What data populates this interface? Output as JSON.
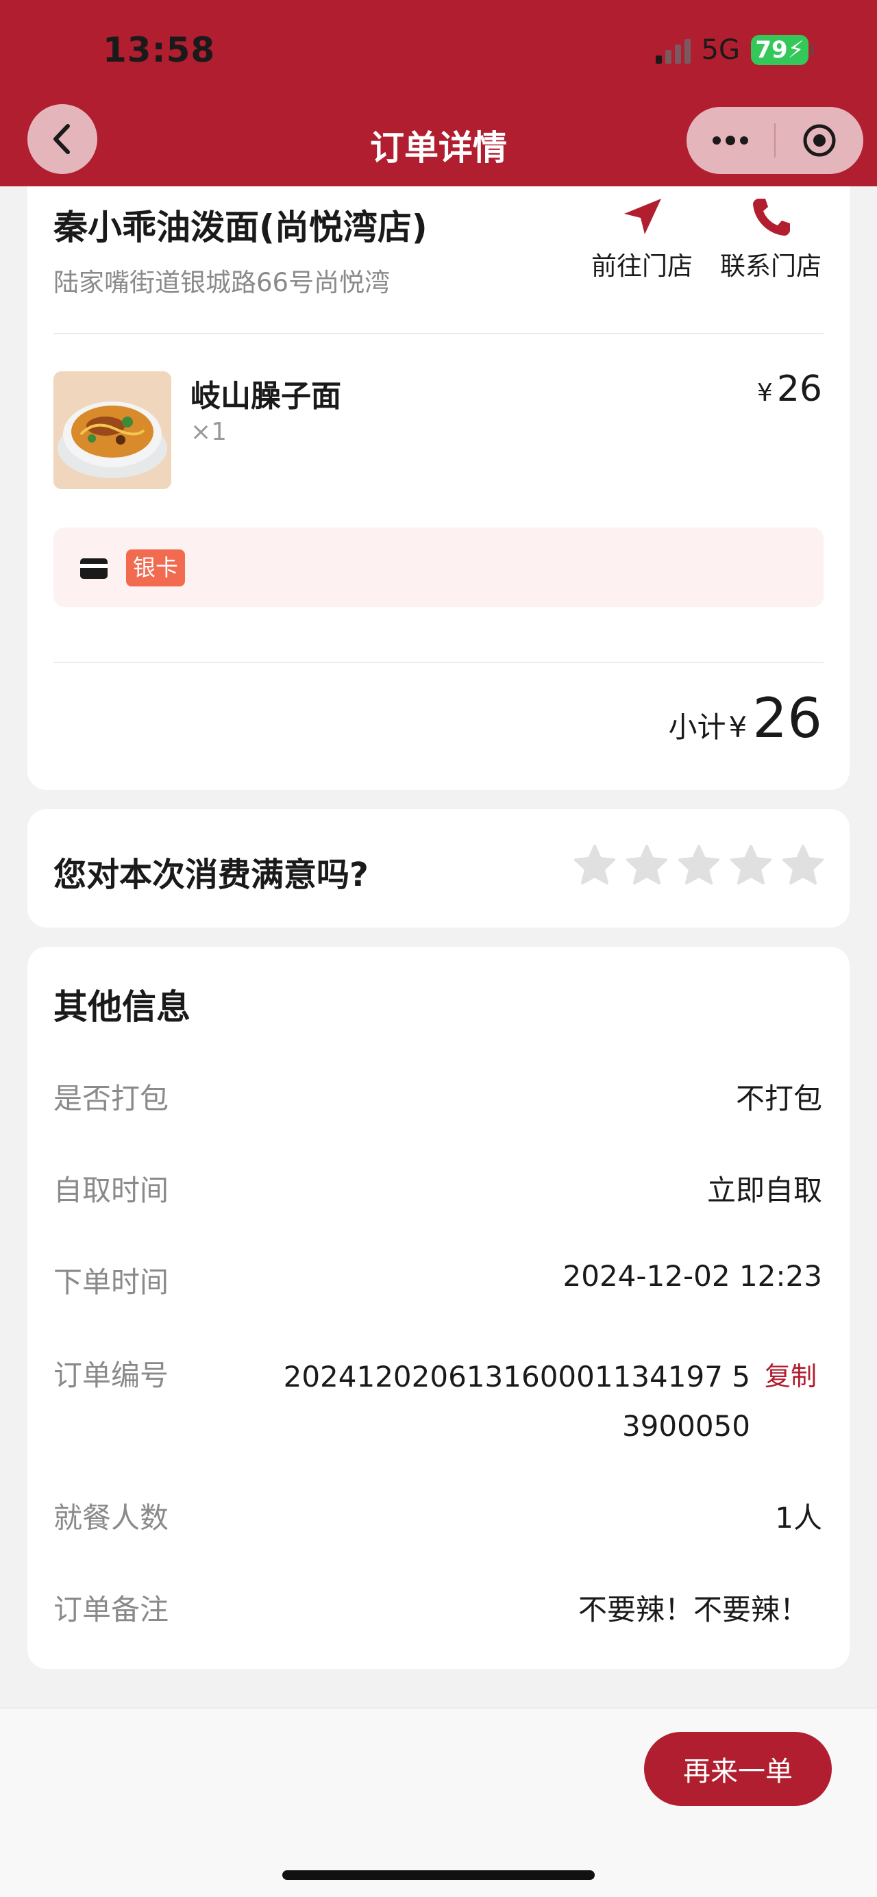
{
  "status": {
    "time": "13:58",
    "network": "5G",
    "battery": "79"
  },
  "nav": {
    "title": "订单详情"
  },
  "store": {
    "name": "秦小乖油泼面(尚悦湾店)",
    "address": "陆家嘴街道银城路66号尚悦湾",
    "navigate_label": "前往门店",
    "call_label": "联系门店"
  },
  "item": {
    "name": "岐山臊子面",
    "qty": "×1",
    "currency": "¥",
    "price": "26"
  },
  "payment": {
    "tag": "银卡"
  },
  "subtotal": {
    "label": "小计",
    "currency": "¥",
    "value": "26"
  },
  "rating": {
    "question": "您对本次消费满意吗?",
    "stars": 5,
    "selected": 0
  },
  "other_info": {
    "title": "其他信息",
    "rows": [
      {
        "label": "是否打包",
        "value": "不打包"
      },
      {
        "label": "自取时间",
        "value": "立即自取"
      },
      {
        "label": "下单时间",
        "value": "2024-12-02 12:23"
      },
      {
        "label": "订单编号",
        "value_line1": "202412020613160001134197 5",
        "value_line2": "3900050"
      },
      {
        "label": "就餐人数",
        "value": "1人"
      },
      {
        "label": "订单备注",
        "value": "不要辣！不要辣！"
      }
    ],
    "copy_label": "复制"
  },
  "bottom": {
    "reorder_label": "再来一单"
  },
  "colors": {
    "brand": "#b01e2f",
    "tag": "#f26a4f",
    "battery": "#34c759"
  }
}
